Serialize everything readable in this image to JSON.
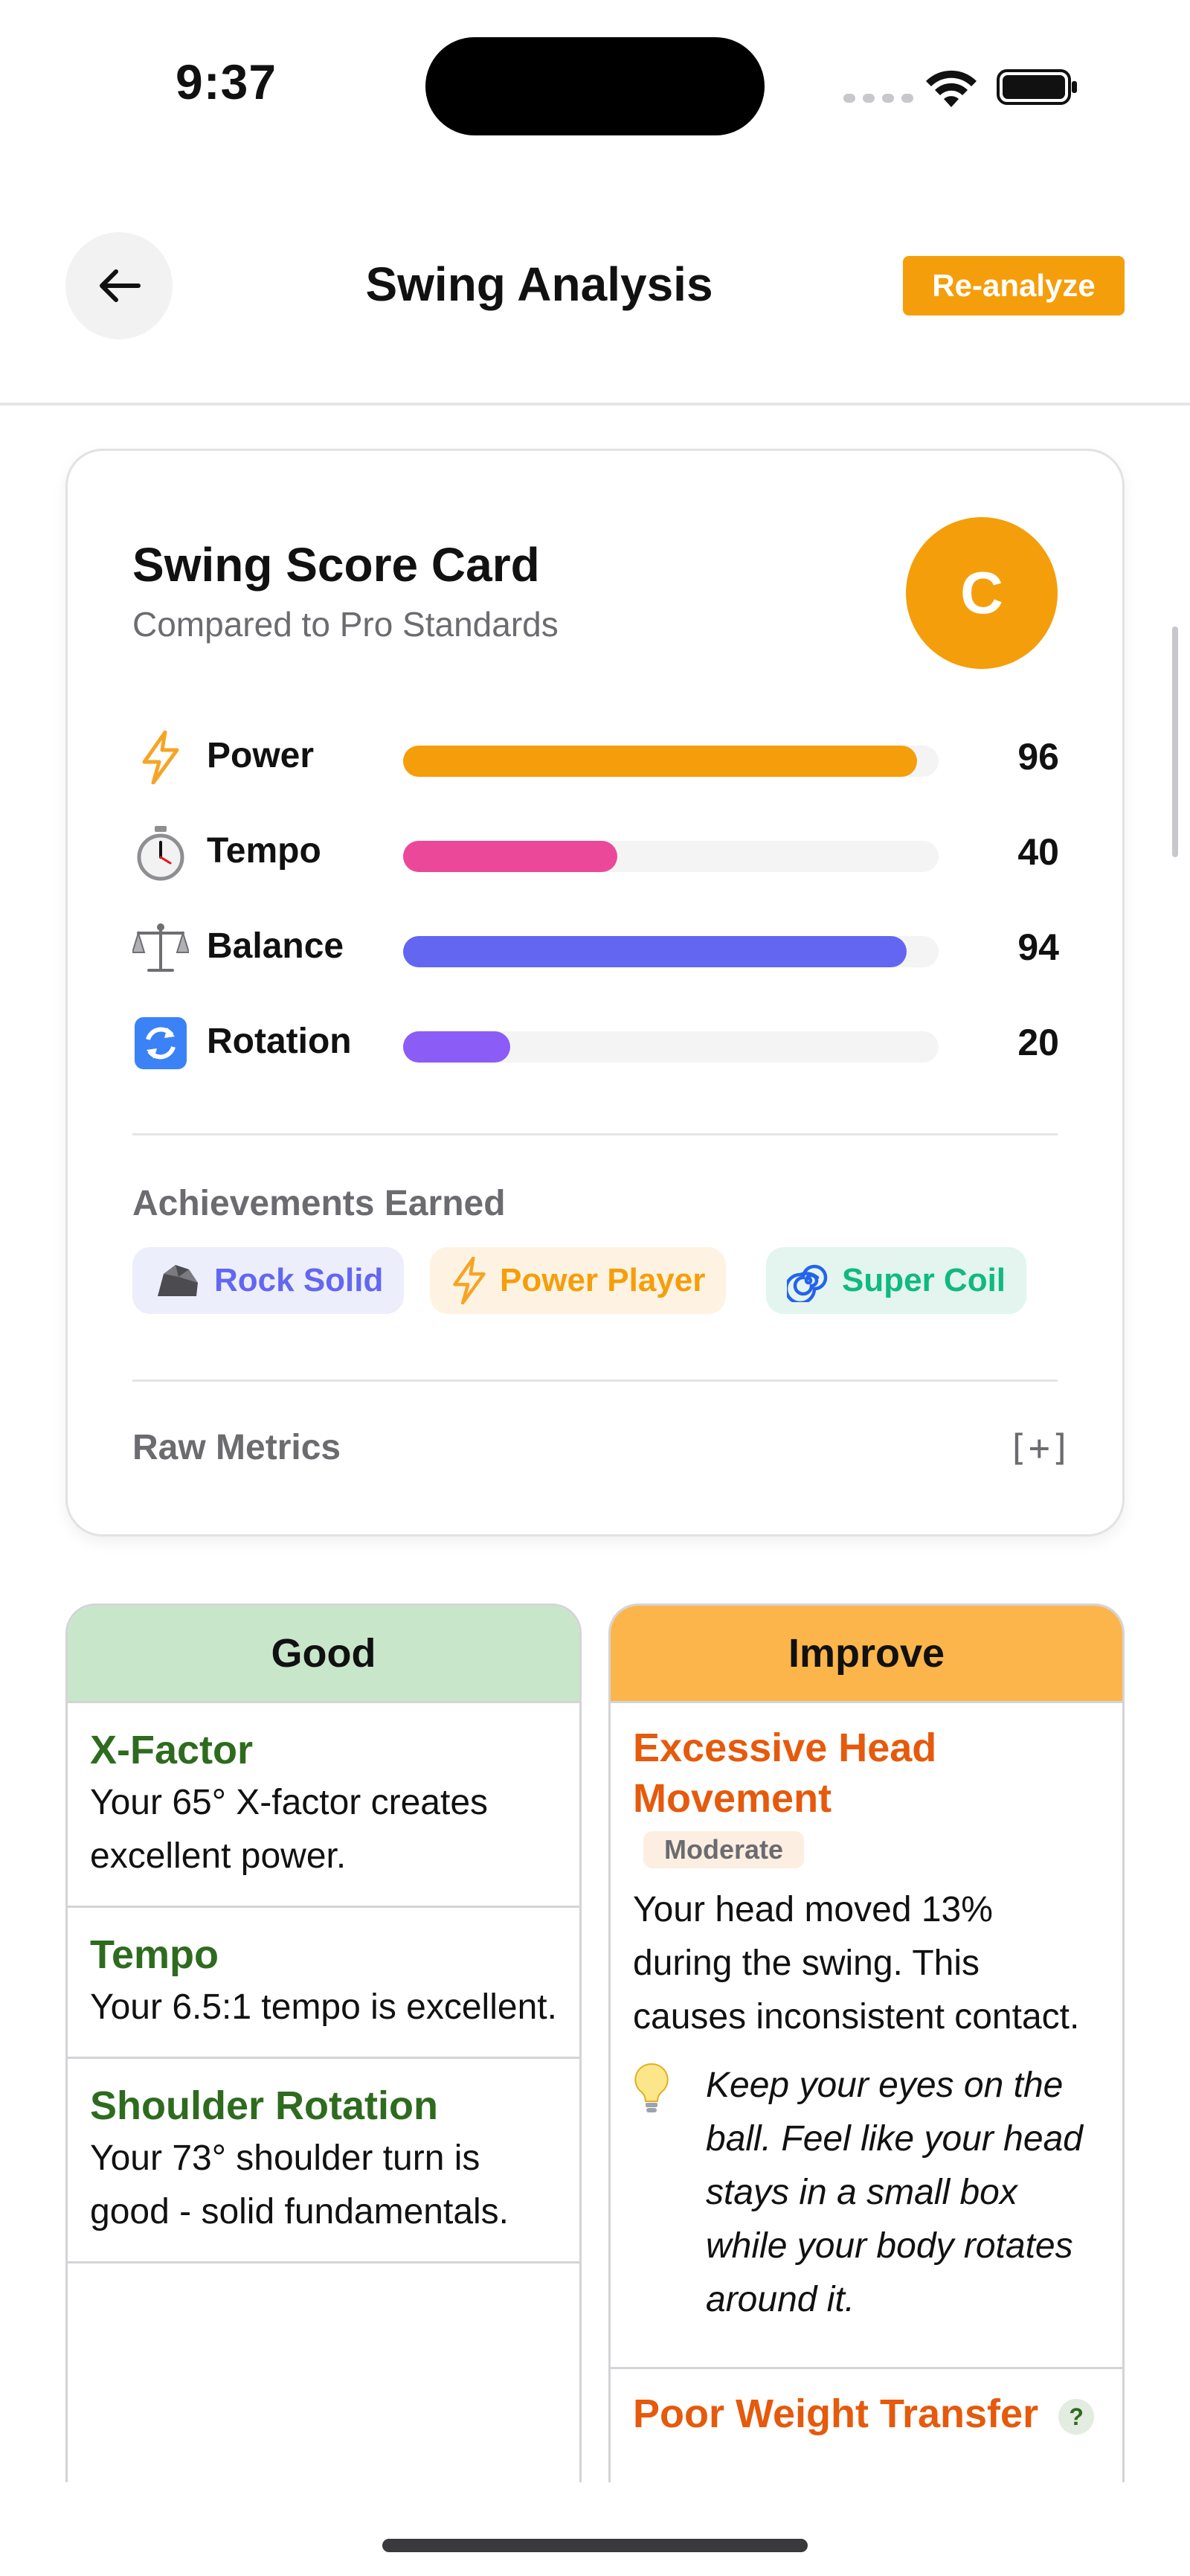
{
  "status_bar": {
    "time": "9:37"
  },
  "header": {
    "title": "Swing Analysis",
    "reanalyze_label": "Re-analyze"
  },
  "score_card": {
    "title": "Swing Score Card",
    "subtitle": "Compared to Pro Standards",
    "grade": "C",
    "metrics": [
      {
        "label": "Power",
        "value": "96",
        "percent": 96,
        "color": "#f59e0b",
        "icon": "lightning-icon"
      },
      {
        "label": "Tempo",
        "value": "40",
        "percent": 40,
        "color": "#ec4899",
        "icon": "stopwatch-icon"
      },
      {
        "label": "Balance",
        "value": "94",
        "percent": 94,
        "color": "#6366f1",
        "icon": "scales-icon"
      },
      {
        "label": "Rotation",
        "value": "20",
        "percent": 20,
        "color": "#8b5cf6",
        "icon": "rotate-icon"
      }
    ],
    "achievements_title": "Achievements Earned",
    "achievements": [
      {
        "label": "Rock Solid",
        "icon": "rock-icon",
        "text_color": "#6366f1",
        "bg_color": "#eceefb"
      },
      {
        "label": "Power Player",
        "icon": "lightning-icon",
        "text_color": "#f59e0b",
        "bg_color": "#fef3e2"
      },
      {
        "label": "Super Coil",
        "icon": "cyclone-icon",
        "text_color": "#10b981",
        "bg_color": "#e3f5ee"
      }
    ],
    "raw_metrics_label": "Raw Metrics",
    "raw_metrics_toggle": "[+]"
  },
  "good": {
    "header": "Good",
    "header_color": "#c8e6c9",
    "items": [
      {
        "title": "X-Factor",
        "text": "Your 65° X-factor creates excellent power."
      },
      {
        "title": "Tempo",
        "text": "Your 6.5:1 tempo is excellent."
      },
      {
        "title": "Shoulder Rotation",
        "text": "Your 73° shoulder turn is good - solid fundamentals."
      }
    ]
  },
  "improve": {
    "header": "Improve",
    "header_color": "#fcb54a",
    "items": [
      {
        "title": "Excessive Head Movement",
        "severity": "Moderate",
        "text": "Your head moved 13% during the swing. This causes inconsistent contact.",
        "tip": "Keep your eyes on the ball. Feel like your head stays in a small box while your body rotates around it.",
        "tip_icon": "lightbulb-icon"
      },
      {
        "title": "Poor Weight Transfer",
        "help": "?"
      }
    ]
  }
}
